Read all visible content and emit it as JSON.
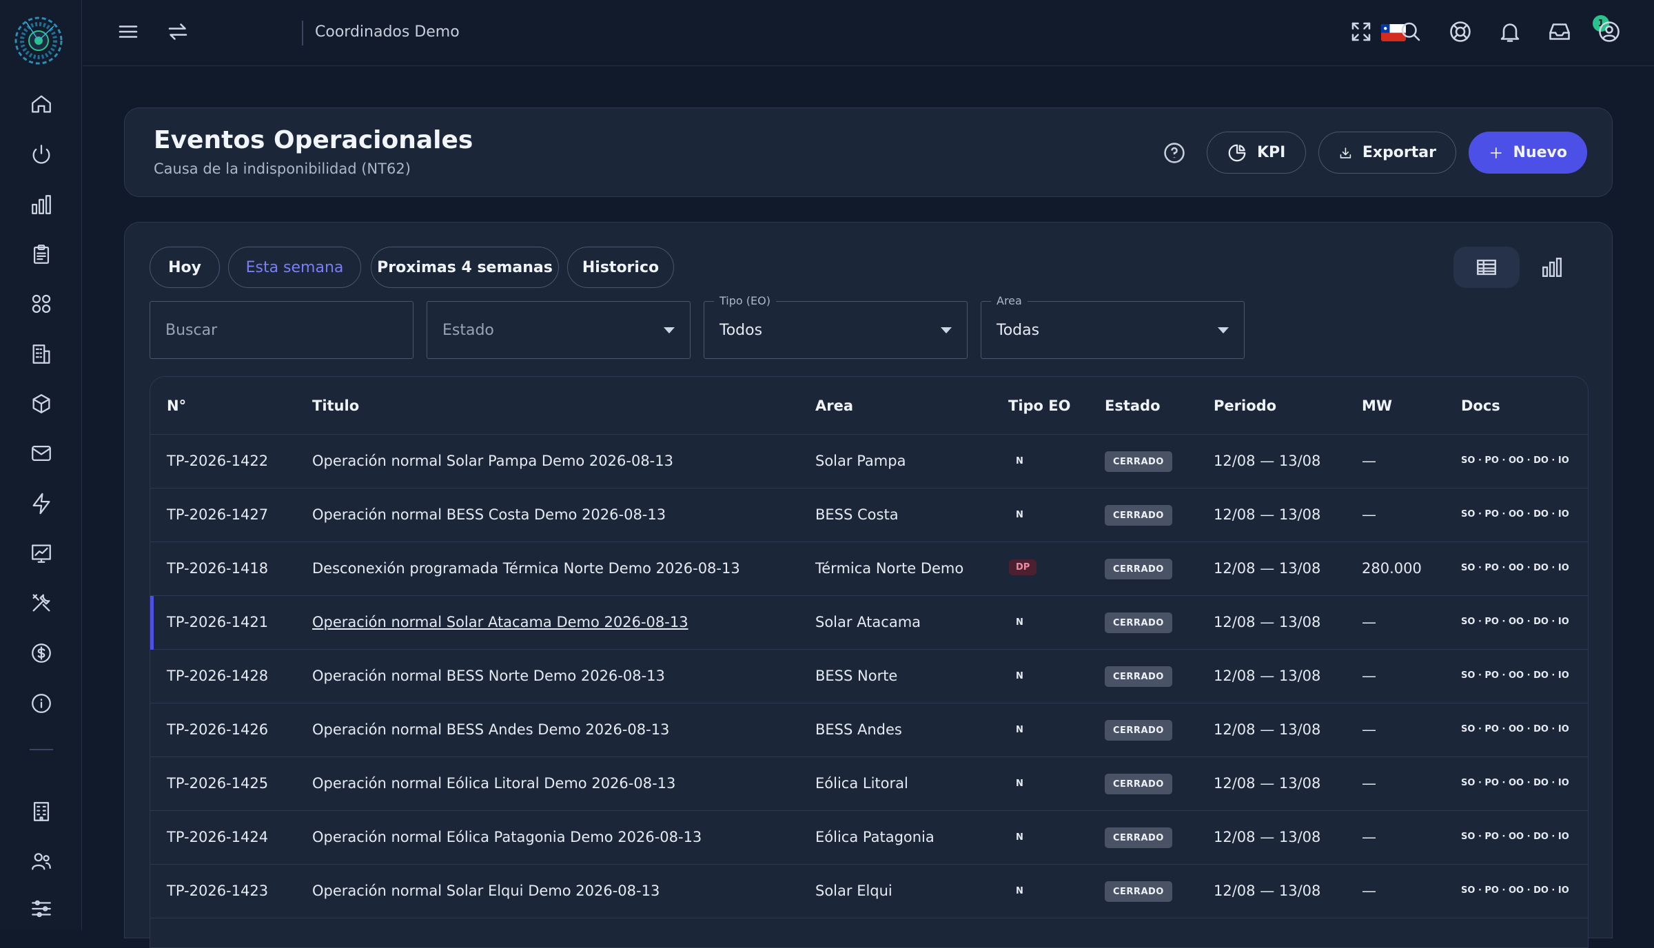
{
  "topbar": {
    "organization": "Coordinados Demo",
    "notification_count": "1"
  },
  "header": {
    "title": "Eventos Operacionales",
    "subtitle": "Causa de la indisponibilidad (NT62)",
    "kpi_label": "KPI",
    "export_label": "Exportar",
    "new_label": "Nuevo"
  },
  "filters": {
    "chips": [
      "Hoy",
      "Esta semana",
      "Proximas 4 semanas",
      "Historico"
    ],
    "active_chip": "Esta semana",
    "search_placeholder": "Buscar",
    "estado_placeholder": "Estado",
    "tipo_label": "Tipo (EO)",
    "tipo_value": "Todos",
    "area_label": "Area",
    "area_value": "Todas"
  },
  "table": {
    "columns": [
      "N°",
      "Titulo",
      "Area",
      "Tipo EO",
      "Estado",
      "Periodo",
      "MW",
      "Docs"
    ],
    "rows": [
      {
        "id": "TP-2026-1422",
        "title": "Operación normal Solar Pampa Demo 2026-08-13",
        "area": "Solar Pampa",
        "tipo": "N",
        "estado": "CERRADO",
        "periodo": "12/08 — 13/08",
        "mw": "—",
        "docs": "SO · PO · OO · DO · IO"
      },
      {
        "id": "TP-2026-1427",
        "title": "Operación normal BESS Costa Demo 2026-08-13",
        "area": "BESS Costa",
        "tipo": "N",
        "estado": "CERRADO",
        "periodo": "12/08 — 13/08",
        "mw": "—",
        "docs": "SO · PO · OO · DO · IO"
      },
      {
        "id": "TP-2026-1418",
        "title": "Desconexión programada Térmica Norte Demo 2026-08-13",
        "area": "Térmica Norte Demo",
        "tipo": "DP",
        "estado": "CERRADO",
        "periodo": "12/08 — 13/08",
        "mw": "280.000",
        "docs": "SO · PO · OO · DO · IO"
      },
      {
        "id": "TP-2026-1421",
        "title": "Operación normal Solar Atacama Demo 2026-08-13",
        "area": "Solar Atacama",
        "tipo": "N",
        "estado": "CERRADO",
        "periodo": "12/08 — 13/08",
        "mw": "—",
        "docs": "SO · PO · OO · DO · IO"
      },
      {
        "id": "TP-2026-1428",
        "title": "Operación normal BESS Norte Demo 2026-08-13",
        "area": "BESS Norte",
        "tipo": "N",
        "estado": "CERRADO",
        "periodo": "12/08 — 13/08",
        "mw": "—",
        "docs": "SO · PO · OO · DO · IO"
      },
      {
        "id": "TP-2026-1426",
        "title": "Operación normal BESS Andes Demo 2026-08-13",
        "area": "BESS Andes",
        "tipo": "N",
        "estado": "CERRADO",
        "periodo": "12/08 — 13/08",
        "mw": "—",
        "docs": "SO · PO · OO · DO · IO"
      },
      {
        "id": "TP-2026-1425",
        "title": "Operación normal Eólica Litoral Demo 2026-08-13",
        "area": "Eólica Litoral",
        "tipo": "N",
        "estado": "CERRADO",
        "periodo": "12/08 — 13/08",
        "mw": "—",
        "docs": "SO · PO · OO · DO · IO"
      },
      {
        "id": "TP-2026-1424",
        "title": "Operación normal Eólica Patagonia Demo 2026-08-13",
        "area": "Eólica Patagonia",
        "tipo": "N",
        "estado": "CERRADO",
        "periodo": "12/08 — 13/08",
        "mw": "—",
        "docs": "SO · PO · OO · DO · IO"
      },
      {
        "id": "TP-2026-1423",
        "title": "Operación normal Solar Elqui Demo 2026-08-13",
        "area": "Solar Elqui",
        "tipo": "N",
        "estado": "CERRADO",
        "periodo": "12/08 — 13/08",
        "mw": "—",
        "docs": "SO · PO · OO · DO · IO"
      }
    ]
  },
  "colors": {
    "background": "#111a2b",
    "card": "#1b2638",
    "primary": "#4c50e6",
    "accent_teal": "#29c48c",
    "dp_badge": "#4b2030"
  },
  "icons": {
    "sidebar": [
      "home-icon",
      "power-icon",
      "bar-chart-icon",
      "clipboard-icon",
      "apps-icon",
      "building-icon",
      "cube-icon",
      "mail-icon",
      "lightning-icon",
      "analytics-icon",
      "tools-icon",
      "dollar-icon",
      "info-icon",
      "office-icon",
      "users-icon",
      "sliders-icon"
    ],
    "topbar": [
      "menu-icon",
      "swap-icon",
      "chile-flag-icon",
      "fullscreen-icon",
      "search-icon",
      "support-icon",
      "bell-icon",
      "inbox-icon",
      "user-icon"
    ]
  }
}
